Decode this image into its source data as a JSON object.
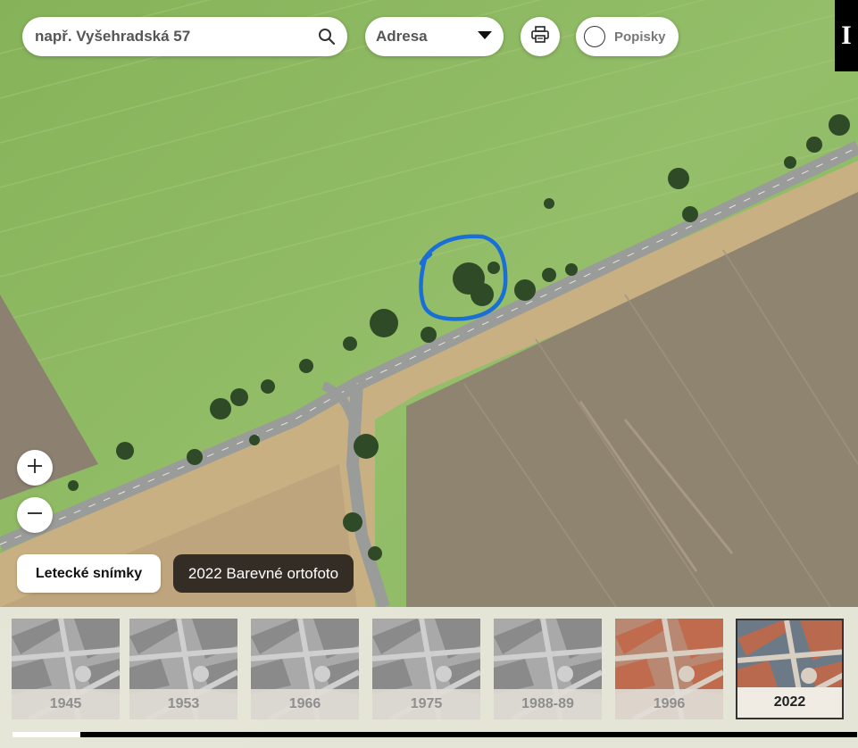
{
  "search": {
    "placeholder": "např. Vyšehradská 57"
  },
  "address_select": {
    "value": "Adresa"
  },
  "print": {
    "icon": "printer-icon"
  },
  "labels_toggle": {
    "label": "Popisky",
    "checked": false
  },
  "info": {
    "label": "I"
  },
  "zoom": {
    "in_icon": "plus-icon",
    "out_icon": "minus-icon"
  },
  "aerial": {
    "button_label": "Letecké snímky",
    "current_layer": "2022 Barevné ortofoto"
  },
  "timeline": {
    "years": [
      {
        "label": "1945",
        "style": "grayscale",
        "active": false
      },
      {
        "label": "1953",
        "style": "grayscale",
        "active": false
      },
      {
        "label": "1966",
        "style": "grayscale",
        "active": false
      },
      {
        "label": "1975",
        "style": "grayscale",
        "active": false
      },
      {
        "label": "1988-89",
        "style": "grayscale",
        "active": false
      },
      {
        "label": "1996",
        "style": "color",
        "active": false
      },
      {
        "label": "2022",
        "style": "color",
        "active": true
      }
    ],
    "scroll_progress": 0.08
  },
  "colors": {
    "field_green": "#8fbb63",
    "field_brown": "#8d8270",
    "stubble": "#cdb48b",
    "road": "#9c9e9c",
    "annotation_blue": "#1a6fd6"
  }
}
